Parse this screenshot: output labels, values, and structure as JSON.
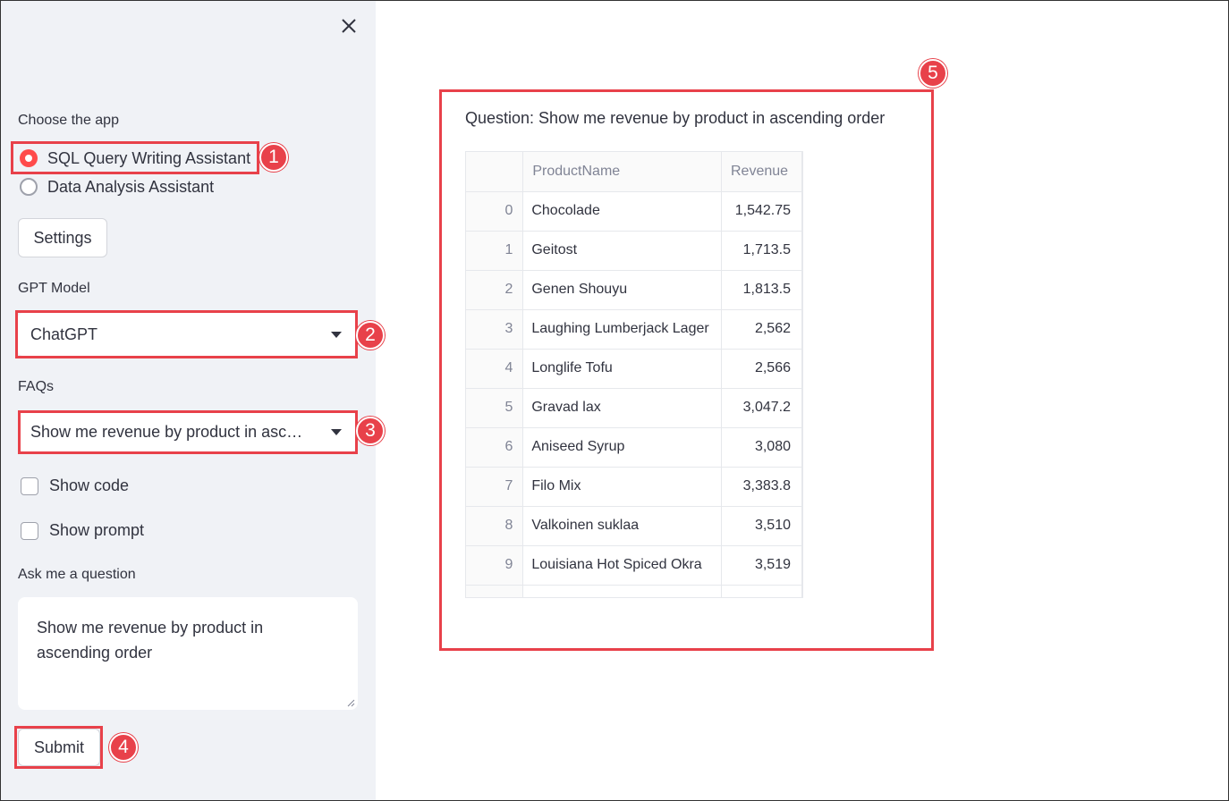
{
  "sidebar": {
    "app_label": "Choose the app",
    "apps": [
      {
        "label": "SQL Query Writing Assistant",
        "selected": true
      },
      {
        "label": "Data Analysis Assistant",
        "selected": false
      }
    ],
    "settings_label": "Settings",
    "gpt_model_label": "GPT Model",
    "gpt_model_value": "ChatGPT",
    "faqs_label": "FAQs",
    "faqs_value": "Show me revenue by product in asc…",
    "show_code_label": "Show code",
    "show_prompt_label": "Show prompt",
    "question_label": "Ask me a question",
    "question_value": "Show me revenue by product in ascending order",
    "submit_label": "Submit"
  },
  "main": {
    "question_text": "Question: Show me revenue by product in ascending order",
    "table": {
      "columns": [
        "",
        "ProductName",
        "Revenue"
      ],
      "rows": [
        {
          "idx": "0",
          "name": "Chocolade",
          "revenue": "1,542.75"
        },
        {
          "idx": "1",
          "name": "Geitost",
          "revenue": "1,713.5"
        },
        {
          "idx": "2",
          "name": "Genen Shouyu",
          "revenue": "1,813.5"
        },
        {
          "idx": "3",
          "name": "Laughing Lumberjack Lager",
          "revenue": "2,562"
        },
        {
          "idx": "4",
          "name": "Longlife Tofu",
          "revenue": "2,566"
        },
        {
          "idx": "5",
          "name": "Gravad lax",
          "revenue": "3,047.2"
        },
        {
          "idx": "6",
          "name": "Aniseed Syrup",
          "revenue": "3,080"
        },
        {
          "idx": "7",
          "name": "Filo Mix",
          "revenue": "3,383.8"
        },
        {
          "idx": "8",
          "name": "Valkoinen suklaa",
          "revenue": "3,510"
        },
        {
          "idx": "9",
          "name": "Louisiana Hot Spiced Okra",
          "revenue": "3,519"
        },
        {
          "idx": "",
          "name": "",
          "revenue": ""
        }
      ]
    }
  },
  "annotations": {
    "badges": [
      "1",
      "2",
      "3",
      "4",
      "5"
    ],
    "color": "#e8414a"
  },
  "colors": {
    "sidebar_bg": "#f0f2f6",
    "accent": "#ff4b4b"
  }
}
